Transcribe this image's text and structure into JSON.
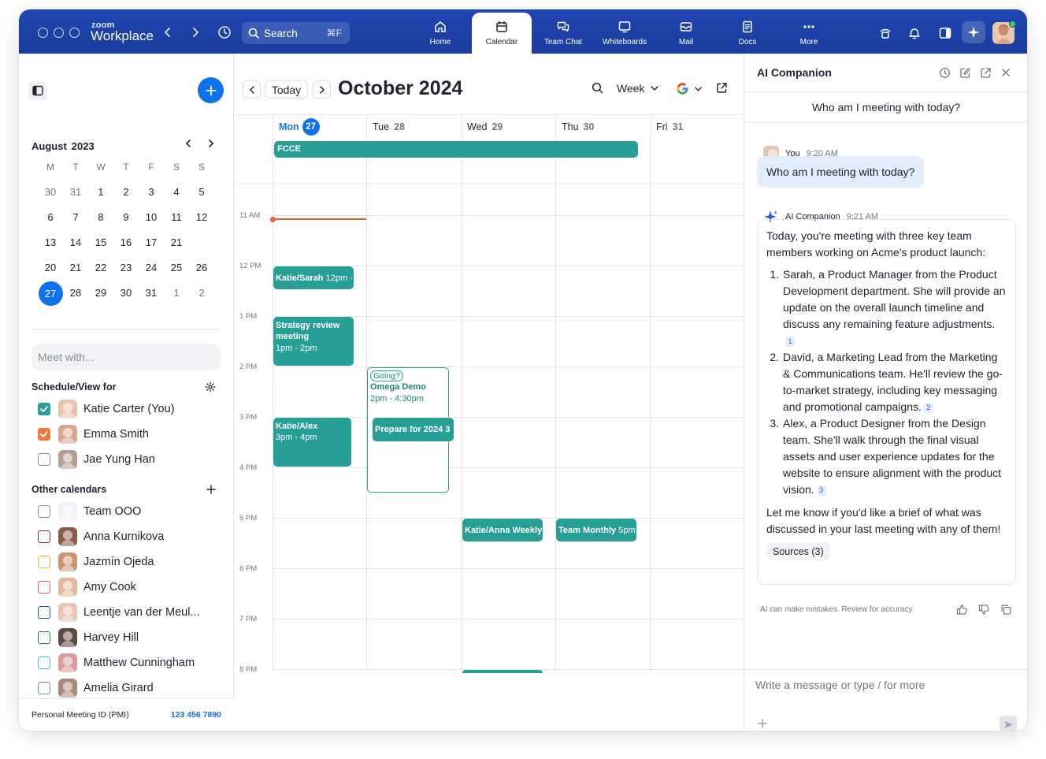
{
  "app": {
    "brand_small": "zoom",
    "brand_big": "Workplace"
  },
  "search": {
    "label": "Search",
    "shortcut": "⌘F"
  },
  "nav": {
    "tabs": [
      {
        "label": "Home",
        "icon": "home-icon"
      },
      {
        "label": "Calendar",
        "icon": "calendar-icon",
        "active": true
      },
      {
        "label": "Team Chat",
        "icon": "chat-icon"
      },
      {
        "label": "Whiteboards",
        "icon": "whiteboard-icon"
      },
      {
        "label": "Mail",
        "icon": "mail-icon"
      },
      {
        "label": "Docs",
        "icon": "docs-icon"
      },
      {
        "label": "More",
        "icon": "more-icon"
      }
    ]
  },
  "colors": {
    "brand_blue": "#0e72ed",
    "topbar": "#1f3fa3",
    "event_teal": "#279e96",
    "now_line": "#e8622c",
    "status_online": "#3ccc59"
  },
  "mini_calendar": {
    "month": "August",
    "year": "2023",
    "weekdays": [
      "M",
      "T",
      "W",
      "T",
      "F",
      "S",
      "S"
    ],
    "weeks": [
      [
        "30",
        "31",
        "1",
        "2",
        "3",
        "4",
        "5"
      ],
      [
        "6",
        "7",
        "8",
        "9",
        "10",
        "11",
        "12"
      ],
      [
        "13",
        "14",
        "15",
        "16",
        "17",
        "21"
      ],
      [
        "20",
        "21",
        "22",
        "23",
        "24",
        "25",
        "26"
      ],
      [
        "27",
        "28",
        "29",
        "30",
        "31",
        "1",
        "2"
      ]
    ],
    "selected": "27"
  },
  "sidebar": {
    "meet_placeholder": "Meet with...",
    "schedule_title": "Schedule/View for",
    "my_calendars": [
      {
        "name": "Katie Carter (You)",
        "checked": true,
        "color": "#279e96",
        "avatar": "#e7c4ad"
      },
      {
        "name": "Emma Smith",
        "checked": true,
        "color": "#f07a3a",
        "avatar": "#d9a98f"
      },
      {
        "name": "Jae Yung Han",
        "checked": false,
        "color": "#6e7680",
        "avatar": "#b59d91"
      }
    ],
    "other_title": "Other calendars",
    "other_calendars": [
      {
        "name": "Team OOO",
        "color": "#6e7680",
        "avatar": "group"
      },
      {
        "name": "Anna Kurnikova",
        "color": "#7a2a5a",
        "avatar": "#8b5a4a"
      },
      {
        "name": "Jazmín Ojeda",
        "color": "#f0b42a",
        "avatar": "#c99574"
      },
      {
        "name": "Amy Cook",
        "color": "#e05a6a",
        "avatar": "#e1b89c"
      },
      {
        "name": "Leentje van der Meul...",
        "color": "#1f4fa0",
        "avatar": "#e9c4b7"
      },
      {
        "name": "Harvey Hill",
        "color": "#2f7a3a",
        "avatar": "#5a4a42"
      },
      {
        "name": "Matthew Cunningham",
        "color": "#4ab8c8",
        "avatar": "#d99c9c"
      },
      {
        "name": "Amelia Girard",
        "color": "#6a8ad8",
        "avatar": "#a98a7a"
      }
    ],
    "pmi_label": "Personal Meeting ID (PMI)",
    "pmi_value": "123 456 7890"
  },
  "calendar": {
    "today_button": "Today",
    "month_title": "October 2024",
    "view": "Week",
    "days": [
      {
        "name": "Mon",
        "num": "27",
        "today": true
      },
      {
        "name": "Tue",
        "num": "28"
      },
      {
        "name": "Wed",
        "num": "29"
      },
      {
        "name": "Thu",
        "num": "30"
      },
      {
        "name": "Fri",
        "num": "31"
      }
    ],
    "times": [
      "11 AM",
      "12 PM",
      "1 PM",
      "2 PM",
      "3 PM",
      "4 PM",
      "5 PM",
      "6 PM",
      "7 PM",
      "8 PM"
    ],
    "all_day_event": "FCCE",
    "events": {
      "katie_sarah": {
        "title": "Katie/Sarah",
        "time": "12pm -"
      },
      "strategy": {
        "title": "Strategy review meeting",
        "time": "1pm - 2pm"
      },
      "omega": {
        "badge": "Going?",
        "title": "Omega Demo",
        "time": "2pm - 4:30pm"
      },
      "prepare": {
        "title": "Prepare for 2024 3"
      },
      "katie_alex": {
        "title": "Katie/Alex",
        "time": "3pm - 4pm"
      },
      "katie_anna": {
        "title": "Katie/Anna Weekly"
      },
      "team_monthly": {
        "title": "Team Monthly",
        "time": "5pm"
      }
    }
  },
  "ai": {
    "title": "AI Companion",
    "topic": "Who am I meeting with today?",
    "user_name": "You",
    "user_time": "9:20 AM",
    "user_message": "Who am I meeting with today?",
    "bot_name": "AI Companion",
    "bot_time": "9:21 AM",
    "intro": "Today, you're meeting with three key team members working on Acme's product launch:",
    "items": [
      {
        "text": "Sarah, a Product Manager from the Product Development department. She will provide an update on the overall launch timeline and discuss any remaining feature adjustments.",
        "cite": "1"
      },
      {
        "text": "David, a Marketing Lead from the Marketing & Communications team. He'll review the go-to-market strategy, including key messaging and promotional campaigns.",
        "cite": "2"
      },
      {
        "text": "Alex, a Product Designer from the Design team. She'll walk through the final visual assets and user experience updates for the website to ensure alignment with the product vision.",
        "cite": "3"
      }
    ],
    "outro": "Let me know if you'd like a brief of what was discussed in your last meeting with any of them!",
    "sources": "Sources (3)",
    "disclaimer": "AI can make mistakes. Review for accuracy.",
    "composer_placeholder": "Write a message or type / for more"
  }
}
